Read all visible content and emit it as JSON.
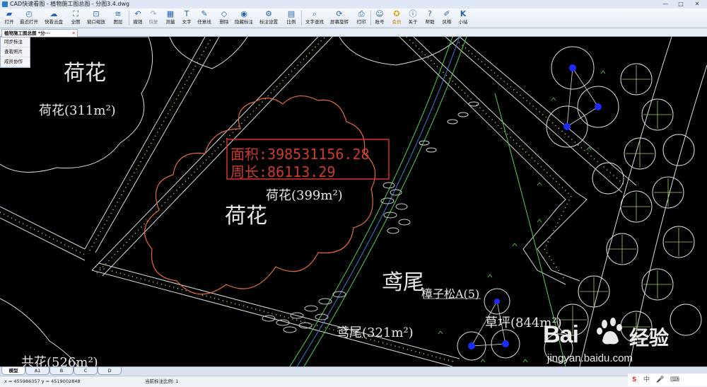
{
  "window": {
    "title": "CAD快速看图 - 植物施工图总图 - 分图3.4.dwg",
    "minimize": "—",
    "maximize": "□",
    "close": "✕"
  },
  "toolbar": {
    "items": [
      {
        "label": "打开",
        "icon": "folder-icon"
      },
      {
        "label": "最近打开",
        "icon": "recent-icon"
      },
      {
        "label": "快看云盘",
        "icon": "cloud-icon"
      },
      {
        "label": "全图",
        "icon": "fit-all-icon"
      },
      {
        "label": "窗口缩放",
        "icon": "window-zoom-icon"
      },
      {
        "label": "图层",
        "icon": "layers-icon"
      },
      {
        "label": "撤销",
        "icon": "undo-icon"
      },
      {
        "label": "恢复",
        "icon": "redo-icon"
      },
      {
        "label": "测量",
        "icon": "measure-icon"
      },
      {
        "label": "文字",
        "icon": "text-icon"
      },
      {
        "label": "任意线",
        "icon": "freeline-icon"
      },
      {
        "label": "删除",
        "icon": "eraser-icon"
      },
      {
        "label": "隐藏标注",
        "icon": "hide-icon"
      },
      {
        "label": "标注设置",
        "icon": "annotation-settings-icon"
      },
      {
        "label": "比例",
        "icon": "scale-icon"
      },
      {
        "label": "文字查找",
        "icon": "text-search-icon"
      },
      {
        "label": "屏幕旋转",
        "icon": "rotate-icon"
      },
      {
        "label": "打印",
        "icon": "print-icon"
      },
      {
        "label": "账号",
        "icon": "account-icon"
      },
      {
        "label": "会员",
        "icon": "vip-icon"
      },
      {
        "label": "关于",
        "icon": "info-icon"
      },
      {
        "label": "帮助",
        "icon": "help-icon"
      },
      {
        "label": "风格",
        "icon": "style-icon"
      },
      {
        "label": "小站",
        "icon": "k-icon"
      }
    ]
  },
  "doc_tab": {
    "label": "植物施工图总图 *分···",
    "close": "✕"
  },
  "side_menu": [
    "同步标注",
    "查看照片",
    "成员协作"
  ],
  "drawing": {
    "measure_area": "面积:398531156.28",
    "measure_perimeter": "周长:86113.29",
    "labels": {
      "lotus_big_1": "荷花",
      "lotus_area_1": "荷花(311m²)",
      "lotus_big_2": "荷花",
      "lotus_area_2": "荷花(399m²)",
      "iris_big": "鸢尾",
      "pine": "樟子松A(5)",
      "iris_area": "鸢尾(321m²)",
      "grass": "草坪(844m²)",
      "partial": "共花(526m²)"
    }
  },
  "layout_tabs": [
    "模型",
    "A1",
    "B",
    "C",
    "D"
  ],
  "status": {
    "coords": "x = 455986357  y = 4519002848",
    "scale": "当前标注比例: 1"
  },
  "watermark": {
    "brand": "Bai",
    "brand_cn": "经验",
    "url": "jingyan.baidu.com"
  },
  "tray": {
    "s": "S",
    "zh": "中",
    "mic": "🎤",
    "kb": "⌨"
  }
}
